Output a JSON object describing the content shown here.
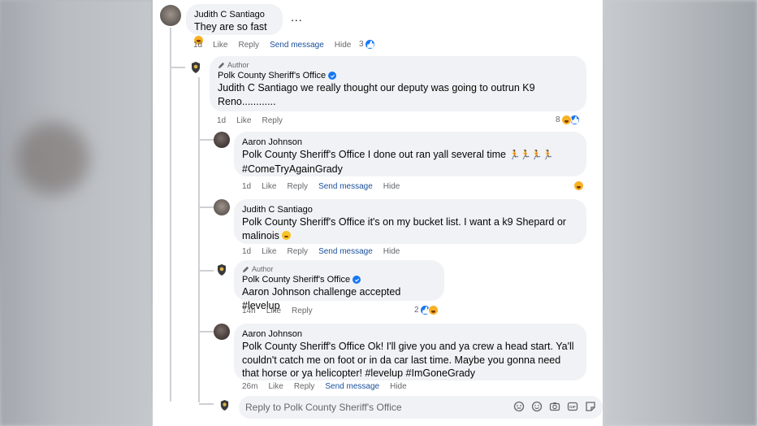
{
  "comments": [
    {
      "name": "Judith C Santiago",
      "text": "They are so fast",
      "more": "...",
      "meta": {
        "time": "1d",
        "like": "Like",
        "reply": "Reply",
        "send": "Send message",
        "hide": "Hide"
      },
      "reactions": {
        "count": "3"
      }
    },
    {
      "author_label": "Author",
      "name": "Polk County Sheriff's Office",
      "mention": "Judith C Santiago",
      "text": " we really thought our deputy was going to outrun K9 Reno............",
      "meta": {
        "time": "1d",
        "like": "Like",
        "reply": "Reply"
      },
      "reactions": {
        "count": "8"
      }
    },
    {
      "name": "Aaron Johnson",
      "mention": "Polk County Sheriff's Office",
      "text": " I done out ran yall several time ",
      "hashtag": "#ComeTryAgainGrady",
      "meta": {
        "time": "1d",
        "like": "Like",
        "reply": "Reply",
        "send": "Send message",
        "hide": "Hide"
      }
    },
    {
      "name": "Judith C Santiago",
      "mention": "Polk County Sheriff's Office",
      "text": " it's on my bucket list. I want a k9 Shepard or malinois ",
      "meta": {
        "time": "1d",
        "like": "Like",
        "reply": "Reply",
        "send": "Send message",
        "hide": "Hide"
      }
    },
    {
      "author_label": "Author",
      "name": "Polk County Sheriff's Office",
      "mention": "Aaron Johnson",
      "text": " challenge accepted ",
      "hashtag": "#levelup",
      "meta": {
        "time": "14h",
        "like": "Like",
        "reply": "Reply"
      },
      "reactions": {
        "count": "2"
      }
    },
    {
      "name": "Aaron Johnson",
      "mention": "Polk County Sheriff's Office",
      "text": " Ok! I'll give you and ya crew a head start. Ya'll couldn't catch me on foot or in da car last time. Maybe you gonna need that horse or ya helicopter! ",
      "hashtag1": "#levelup",
      "hashtag2": "#ImGoneGrady",
      "meta": {
        "time": "26m",
        "like": "Like",
        "reply": "Reply",
        "send": "Send message",
        "hide": "Hide"
      }
    }
  ],
  "reply_box": {
    "placeholder": "Reply to Polk County Sheriff's Office"
  },
  "icons": {
    "verified": "verified-badge-icon",
    "like_reaction": "like-reaction-icon",
    "haha_reaction": "haha-reaction-icon",
    "runner": "runner-emoji-icon",
    "cry": "crying-emoji-icon",
    "pencil": "pencil-icon",
    "reply_tools": [
      "avatar-sticker-icon",
      "emoji-icon",
      "camera-icon",
      "gif-icon",
      "sticker-icon"
    ]
  },
  "colors": {
    "accent": "#1877f2",
    "link": "#1b4f9c",
    "bubble": "#f0f2f5",
    "meta": "#65676b"
  }
}
